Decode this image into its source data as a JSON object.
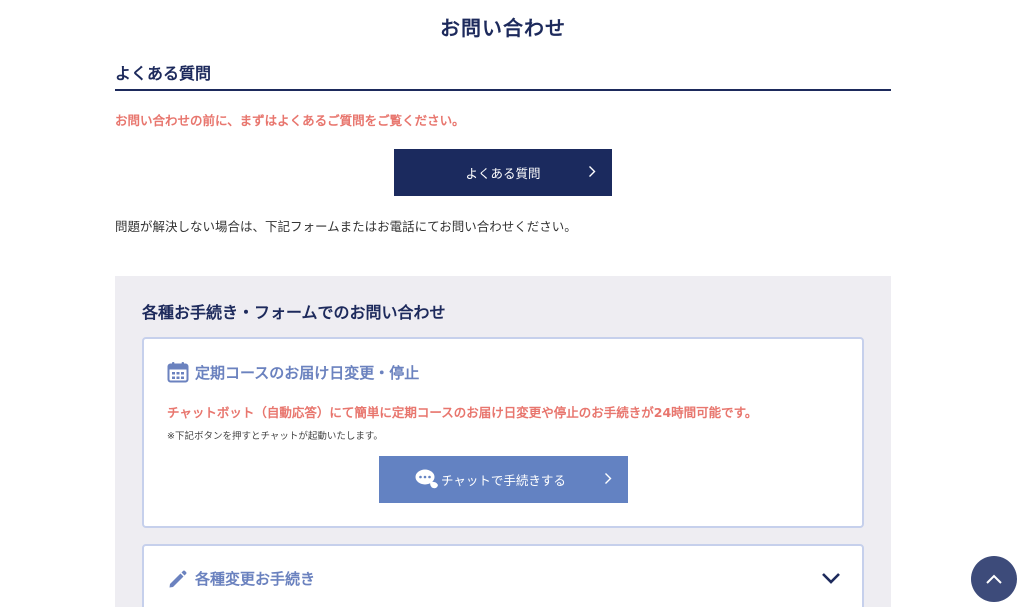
{
  "page": {
    "title": "お問い合わせ"
  },
  "faq": {
    "heading": "よくある質問",
    "notice": "お問い合わせの前に、まずはよくあるご質問をご覧ください。",
    "button_label": "よくある質問",
    "help_text": "問題が解決しない場合は、下記フォームまたはお電話にてお問い合わせください。"
  },
  "forms": {
    "title": "各種お手続き・フォームでのお問い合わせ",
    "delivery_card": {
      "title": "定期コースのお届け日変更・停止",
      "notice": "チャットボット（自動応答）にて簡単に定期コースのお届け日変更や停止のお手続きが24時間可能です。",
      "note": "※下記ボタンを押すとチャットが起動いたします。",
      "button_label": "チャットで手続きする"
    },
    "changes_card": {
      "title": "各種変更お手続き"
    }
  },
  "icons": {
    "chevron_right": "chevron-right-icon",
    "calendar": "calendar-icon",
    "chat": "chat-bubble-icon",
    "pencil": "pencil-icon",
    "chevron_down": "chevron-down-icon",
    "chevron_up": "chevron-up-icon"
  },
  "colors": {
    "navy": "#1b2a5e",
    "accent_blue": "#6382c2",
    "title_blue": "#6b82bf",
    "notice_red": "#e8766e",
    "panel_bg": "#eeedf2",
    "scroll_button": "#3d4b7a"
  }
}
